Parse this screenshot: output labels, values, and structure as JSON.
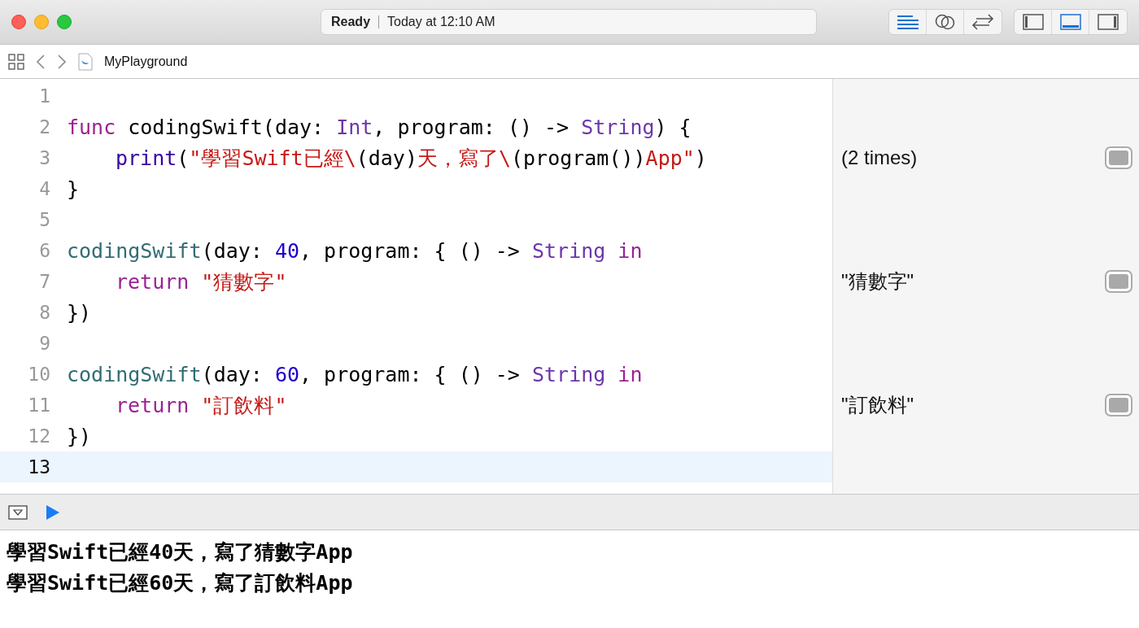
{
  "window": {
    "status": "Ready",
    "timestamp": "Today at 12:10 AM"
  },
  "toolbar": {
    "editor_buttons": [
      {
        "kind": "standard",
        "selected": true
      },
      {
        "kind": "assistant",
        "selected": false
      },
      {
        "kind": "version",
        "selected": false
      }
    ],
    "panel_buttons": [
      {
        "kind": "navigator",
        "selected": false
      },
      {
        "kind": "debug",
        "selected": true
      },
      {
        "kind": "inspector",
        "selected": false
      }
    ]
  },
  "breadcrumb": {
    "file": "MyPlayground"
  },
  "lines": [
    {
      "number": "1",
      "current": false
    },
    {
      "number": "2",
      "current": false,
      "tokens": [
        {
          "kind": "keyword",
          "text": "func"
        },
        {
          "kind": "plain",
          "text": " codingSwift(day: "
        },
        {
          "kind": "type",
          "text": "Int"
        },
        {
          "kind": "plain",
          "text": ", program: () -> "
        },
        {
          "kind": "type",
          "text": "String"
        },
        {
          "kind": "plain",
          "text": ") {"
        }
      ],
      "children": [
        {
          "number": "3",
          "current": false,
          "result": "(2 times)",
          "tokens": [
            {
              "kind": "builtin",
              "text": "print"
            },
            {
              "kind": "plain",
              "text": "("
            },
            {
              "kind": "string",
              "text": "\"學習Swift已經\\"
            },
            {
              "kind": "plain",
              "text": "(day)"
            },
            {
              "kind": "string",
              "text": "天，寫了\\"
            },
            {
              "kind": "plain",
              "text": "(program())"
            },
            {
              "kind": "string",
              "text": "App\""
            },
            {
              "kind": "plain",
              "text": ")"
            }
          ]
        }
      ]
    },
    {
      "number": "4",
      "current": false,
      "tokens": [
        {
          "kind": "plain",
          "text": "}"
        }
      ]
    },
    {
      "number": "5",
      "current": false
    },
    {
      "number": "6",
      "current": false,
      "tokens": [
        {
          "kind": "call",
          "text": "codingSwift"
        },
        {
          "kind": "plain",
          "text": "(day: "
        },
        {
          "kind": "number",
          "text": "40"
        },
        {
          "kind": "plain",
          "text": ", program: { () -> "
        },
        {
          "kind": "type",
          "text": "String"
        },
        {
          "kind": "keyword",
          "text": " in"
        }
      ],
      "children": [
        {
          "number": "7",
          "current": false,
          "result": "\"猜數字\"",
          "tokens": [
            {
              "kind": "keyword",
              "text": "return"
            },
            {
              "kind": "string",
              "text": " \"猜數字\""
            }
          ]
        }
      ]
    },
    {
      "number": "8",
      "current": false,
      "tokens": [
        {
          "kind": "plain",
          "text": "})"
        }
      ]
    },
    {
      "number": "9",
      "current": false
    },
    {
      "number": "10",
      "current": false,
      "tokens": [
        {
          "kind": "call",
          "text": "codingSwift"
        },
        {
          "kind": "plain",
          "text": "(day: "
        },
        {
          "kind": "number",
          "text": "60"
        },
        {
          "kind": "plain",
          "text": ", program: { () -> "
        },
        {
          "kind": "type",
          "text": "String"
        },
        {
          "kind": "keyword",
          "text": " in"
        }
      ],
      "children": [
        {
          "number": "11",
          "current": false,
          "result": "\"訂飲料\"",
          "tokens": [
            {
              "kind": "keyword",
              "text": "return"
            },
            {
              "kind": "string",
              "text": " \"訂飲料\""
            }
          ]
        }
      ]
    },
    {
      "number": "12",
      "current": false,
      "tokens": [
        {
          "kind": "plain",
          "text": "})"
        }
      ]
    },
    {
      "number": "13",
      "current": true
    }
  ],
  "console": [
    "學習Swift已經40天，寫了猜數字App",
    "學習Swift已經60天，寫了訂飲料App"
  ]
}
